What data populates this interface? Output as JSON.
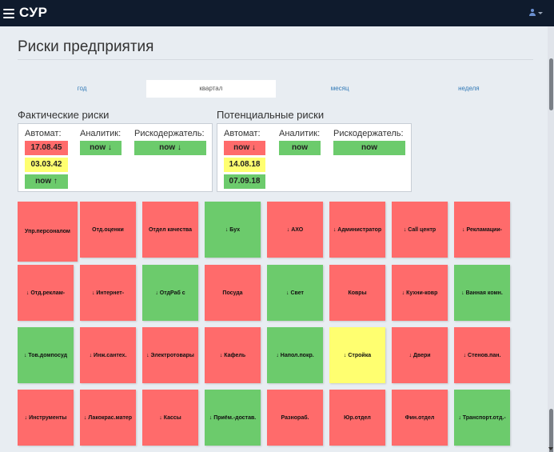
{
  "app": {
    "brand": "СУР"
  },
  "page": {
    "title": "Риски предприятия"
  },
  "tabs": [
    {
      "label": "год",
      "active": false
    },
    {
      "label": "квартал",
      "active": true
    },
    {
      "label": "месяц",
      "active": false
    },
    {
      "label": "неделя",
      "active": false
    }
  ],
  "actual": {
    "title": "Фактические риски",
    "auto_label": "Автомат:",
    "analyst_label": "Аналитик:",
    "owner_label": "Рискодержатель:",
    "auto": [
      {
        "text": "17.08.45",
        "color": "red"
      },
      {
        "text": "03.03.42",
        "color": "yellow"
      },
      {
        "text": "now ↑",
        "color": "green"
      }
    ],
    "analyst": {
      "text": "now ↓",
      "color": "green"
    },
    "owner": {
      "text": "now ↓",
      "color": "green"
    }
  },
  "potential": {
    "title": "Потенциальные риски",
    "auto_label": "Автомат:",
    "analyst_label": "Аналитик:",
    "owner_label": "Рискодержатель:",
    "auto": [
      {
        "text": "now ↓",
        "color": "red"
      },
      {
        "text": "14.08.18",
        "color": "yellow"
      },
      {
        "text": "07.09.18",
        "color": "green"
      }
    ],
    "analyst": {
      "text": "now",
      "color": "green"
    },
    "owner": {
      "text": "now",
      "color": "green"
    }
  },
  "colors": {
    "red": "#ff6b6b",
    "green": "#6ccb6c",
    "yellow": "#ffff70",
    "navbar": "#0f1b2d"
  },
  "departments": [
    {
      "label": "Упр.персоналом",
      "color": "red"
    },
    {
      "label": "Отд.оценки",
      "color": "red"
    },
    {
      "label": "Отдел качества",
      "color": "red"
    },
    {
      "label": "↓ Бух",
      "color": "green"
    },
    {
      "label": "↓ АХО",
      "color": "red"
    },
    {
      "label": "↓ Администратор",
      "color": "red"
    },
    {
      "label": "↓ Call центр",
      "color": "red"
    },
    {
      "label": "↓ Рекламации-",
      "color": "red"
    },
    {
      "label": "↓ Отд.реклам-",
      "color": "red"
    },
    {
      "label": "↓ Интернет-",
      "color": "red"
    },
    {
      "label": "↓ ОтдРаб с",
      "color": "green"
    },
    {
      "label": "Посуда",
      "color": "red"
    },
    {
      "label": "↓ Свет",
      "color": "green"
    },
    {
      "label": "Ковры",
      "color": "red"
    },
    {
      "label": "↓ Кухни-ковр",
      "color": "red"
    },
    {
      "label": "↓ Ванная комн.",
      "color": "green"
    },
    {
      "label": "↓ Тов.домпосуд",
      "color": "green"
    },
    {
      "label": "↓ Инж.сантех.",
      "color": "red"
    },
    {
      "label": "↓ Электротовары",
      "color": "red"
    },
    {
      "label": "↓ Кафель",
      "color": "red"
    },
    {
      "label": "↓ Напол.покр.",
      "color": "green"
    },
    {
      "label": "↓ Стройка",
      "color": "yellow"
    },
    {
      "label": "↓ Двери",
      "color": "red"
    },
    {
      "label": "↓ Стенов.пан.",
      "color": "red"
    },
    {
      "label": "↓ Инструменты",
      "color": "red"
    },
    {
      "label": "↓ Лакокрас.матер",
      "color": "red"
    },
    {
      "label": "↓ Кассы",
      "color": "red"
    },
    {
      "label": "↓ Приём.-достав.",
      "color": "green"
    },
    {
      "label": "Разнораб.",
      "color": "red"
    },
    {
      "label": "Юр.отдел",
      "color": "red"
    },
    {
      "label": "Фин.отдел",
      "color": "red"
    },
    {
      "label": "↓ Транспорт.отд.-",
      "color": "green"
    }
  ]
}
